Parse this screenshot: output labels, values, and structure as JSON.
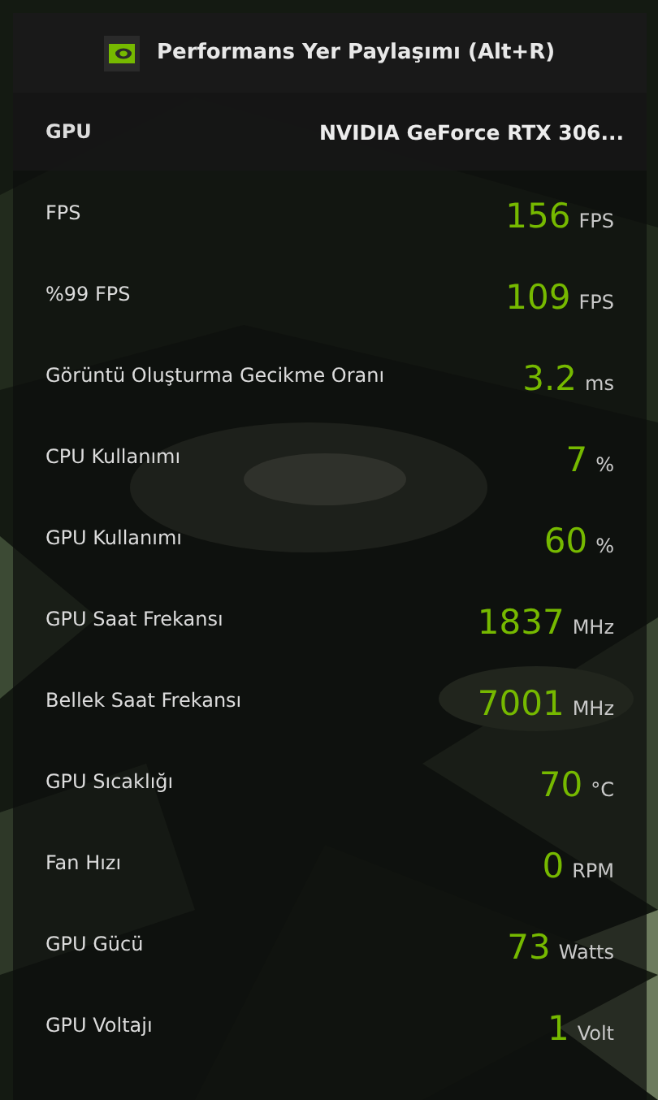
{
  "header": {
    "title": "Performans Yer Paylaşımı (Alt+R)"
  },
  "gpu": {
    "label": "GPU",
    "value": "NVIDIA GeForce RTX 306..."
  },
  "metrics": [
    {
      "label": "FPS",
      "value": "156",
      "unit": "FPS"
    },
    {
      "label": "%99 FPS",
      "value": "109",
      "unit": "FPS"
    },
    {
      "label": "Görüntü Oluşturma Gecikme Oranı",
      "value": "3.2",
      "unit": "ms"
    },
    {
      "label": "CPU Kullanımı",
      "value": "7",
      "unit": "%"
    },
    {
      "label": "GPU Kullanımı",
      "value": "60",
      "unit": "%"
    },
    {
      "label": "GPU Saat Frekansı",
      "value": "1837",
      "unit": "MHz"
    },
    {
      "label": "Bellek Saat Frekansı",
      "value": "7001",
      "unit": "MHz"
    },
    {
      "label": "GPU Sıcaklığı",
      "value": "70",
      "unit": "°C"
    },
    {
      "label": "Fan Hızı",
      "value": "0",
      "unit": "RPM"
    },
    {
      "label": "GPU Gücü",
      "value": "73",
      "unit": "Watts"
    },
    {
      "label": "GPU Voltajı",
      "value": "1",
      "unit": "Volt"
    }
  ]
}
